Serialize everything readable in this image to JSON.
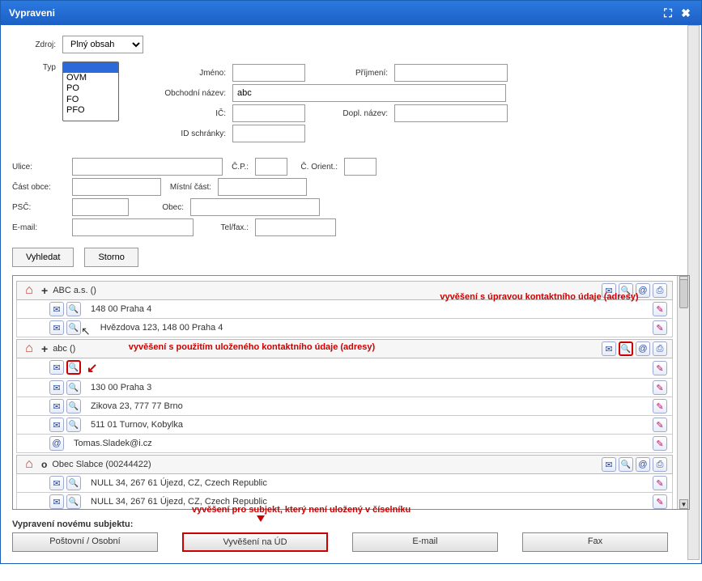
{
  "window": {
    "title": "Vypraveni"
  },
  "source": {
    "label": "Zdroj:",
    "value": "Plný obsah"
  },
  "typ": {
    "label": "Typ",
    "options": [
      "OVM",
      "PO",
      "FO",
      "PFO"
    ],
    "selected": ""
  },
  "form": {
    "jmeno": {
      "label": "Jméno:",
      "value": ""
    },
    "prijmeni": {
      "label": "Příjmení:",
      "value": ""
    },
    "obchnazev": {
      "label": "Obchodní název:",
      "value": "abc"
    },
    "ic": {
      "label": "IČ:",
      "value": ""
    },
    "doplnazev": {
      "label": "Dopl. název:",
      "value": ""
    },
    "idschranky": {
      "label": "ID schránky:",
      "value": ""
    },
    "ulice": {
      "label": "Ulice:",
      "value": ""
    },
    "cp": {
      "label": "Č.P.:",
      "value": ""
    },
    "corient": {
      "label": "Č. Orient.:",
      "value": ""
    },
    "castobce": {
      "label": "Část obce:",
      "value": ""
    },
    "mistnicast": {
      "label": "Místní část:",
      "value": ""
    },
    "psc": {
      "label": "PSČ:",
      "value": ""
    },
    "obec": {
      "label": "Obec:",
      "value": ""
    },
    "email": {
      "label": "E-mail:",
      "value": ""
    },
    "telfax": {
      "label": "Tel/fax.:",
      "value": ""
    }
  },
  "buttons": {
    "search": "Vyhledat",
    "cancel": "Storno"
  },
  "annotations": {
    "top_right": "vyvěšení s úpravou kontaktního údaje (adresy)",
    "mid_left": "vyvěšení s použitím uloženého kontaktního údaje (adresy)",
    "bottom": "vyvěšení pro subjekt, který není uložený v číselníku"
  },
  "subjects": [
    {
      "name": "ABC a.s. ()",
      "expander": "+",
      "addresses": [
        {
          "text": "148 00 Praha 4",
          "icons_left": [
            "env",
            "mag"
          ],
          "icons_right": [
            "edit"
          ]
        },
        {
          "text": "Hvězdova 123, 148 00 Praha 4",
          "icons_left": [
            "env",
            "mag"
          ],
          "icons_right": [
            "edit"
          ],
          "cursor": true
        }
      ]
    },
    {
      "name": "abc ()",
      "expander": "+",
      "highlight_mag": true,
      "addresses": [
        {
          "text": "",
          "icons_left": [
            "env",
            "mag"
          ],
          "icons_right": [
            "edit"
          ],
          "mag_boxed": true
        },
        {
          "text": "130 00 Praha 3",
          "icons_left": [
            "env",
            "mag"
          ],
          "icons_right": [
            "edit"
          ]
        },
        {
          "text": "Zikova 23, 777 77 Brno",
          "icons_left": [
            "env",
            "mag"
          ],
          "icons_right": [
            "edit"
          ]
        },
        {
          "text": "511 01 Turnov, Kobylka",
          "icons_left": [
            "env",
            "mag"
          ],
          "icons_right": [
            "edit"
          ]
        },
        {
          "text": "Tomas.Sladek@i.cz",
          "icons_left": [
            "at"
          ],
          "icons_right": [
            "edit"
          ]
        }
      ]
    },
    {
      "name": "Obec Slabce (00244422)",
      "expander": "o",
      "addresses": [
        {
          "text": "NULL 34, 267 61 Újezd, CZ, Czech Republic",
          "icons_left": [
            "env",
            "mag"
          ],
          "icons_right": [
            "edit"
          ]
        },
        {
          "text": "NULL 34, 267 61 Újezd, CZ, Czech Republic",
          "icons_left": [
            "env",
            "mag"
          ],
          "icons_right": [
            "edit"
          ]
        }
      ]
    }
  ],
  "bottom": {
    "label": "Vypravení novému subjektu:",
    "buttons": [
      "Poštovní / Osobní",
      "Vyvěšení na ÚD",
      "E-mail",
      "Fax"
    ],
    "highlight_index": 1
  }
}
